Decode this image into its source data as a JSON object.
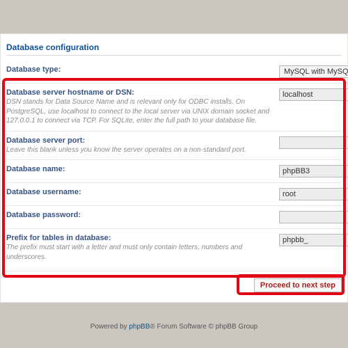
{
  "section": {
    "title": "Database configuration"
  },
  "fields": {
    "db_type": {
      "label": "Database type:",
      "value": "MySQL with MySQLi Exten"
    },
    "db_host": {
      "label": "Database server hostname or DSN:",
      "help": "DSN stands for Data Source Name and is relevant only for ODBC installs. On PostgreSQL, use localhost to connect to the local server via UNIX domain socket and 127.0.0.1 to connect via TCP. For SQLite, enter the full path to your database file.",
      "value": "localhost"
    },
    "db_port": {
      "label": "Database server port:",
      "help": "Leave this blank unless you know the server operates on a non-standard port.",
      "value": ""
    },
    "db_name": {
      "label": "Database name:",
      "value": "phpBB3"
    },
    "db_user": {
      "label": "Database username:",
      "value": "root"
    },
    "db_pass": {
      "label": "Database password:",
      "value": ""
    },
    "db_prefix": {
      "label": "Prefix for tables in database:",
      "help": "The prefix must start with a letter and must only contain letters, numbers and underscores.",
      "value": "phpbb_"
    }
  },
  "submit": {
    "label": "Proceed to next step"
  },
  "footer": {
    "prefix": "Powered by ",
    "brand": "phpBB",
    "suffix": "® Forum Software © phpBB Group"
  },
  "colors": {
    "highlight": "#e30613",
    "heading": "#115098"
  }
}
